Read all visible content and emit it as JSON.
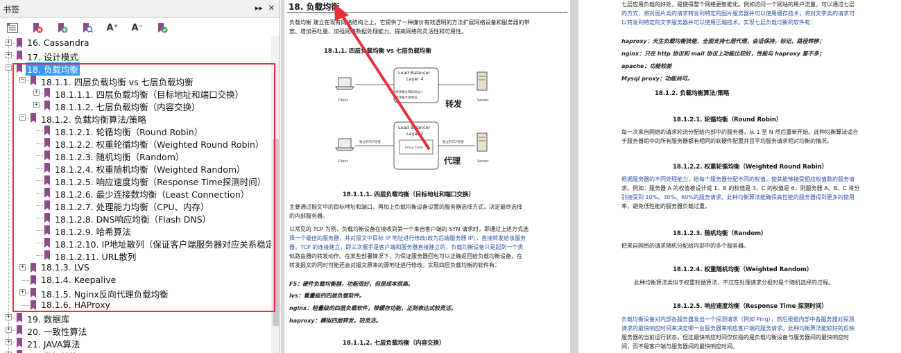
{
  "panel": {
    "title": "书签",
    "header_buttons": [
      "▸▸",
      "✕"
    ],
    "toolbar": [
      {
        "icon": "options-icon"
      },
      {
        "icon": "delete-bookmark-icon"
      },
      {
        "icon": "new-bookmark-icon"
      },
      {
        "icon": "find-bookmark-icon"
      },
      {
        "icon": "expand-text-icon",
        "text": "A⁺"
      },
      {
        "icon": "shrink-text-icon",
        "text": "A⁻"
      },
      {
        "icon": "add-child-bookmark-icon"
      }
    ]
  },
  "tree": [
    {
      "label": "16. Cassandra",
      "level": 0,
      "expander": "+"
    },
    {
      "label": "17. 设计模式",
      "level": 0,
      "expander": "+"
    },
    {
      "label": "18. 负载均衡",
      "level": 0,
      "expander": "−",
      "selected": true
    },
    {
      "label": "18.1.1. 四层负载均衡 vs 七层负载均衡",
      "level": 1,
      "expander": "−"
    },
    {
      "label": "18.1.1.1.  四层负载均衡（目标地址和端口交换）",
      "level": 2,
      "expander": "+"
    },
    {
      "label": "18.1.1.2. 七层负载均衡（内容交换）",
      "level": 2,
      "expander": "+"
    },
    {
      "label": "18.1.2. 负载均衡算法/策略",
      "level": 1,
      "expander": "−"
    },
    {
      "label": "18.1.2.1. 轮循均衡（Round Robin）",
      "level": 2,
      "expander": ""
    },
    {
      "label": "18.1.2.2. 权重轮循均衡（Weighted Round Robin）",
      "level": 2,
      "expander": ""
    },
    {
      "label": "18.1.2.3. 随机均衡（Random）",
      "level": 2,
      "expander": ""
    },
    {
      "label": "18.1.2.4. 权重随机均衡（Weighted Random）",
      "level": 2,
      "expander": ""
    },
    {
      "label": "18.1.2.5. 响应速度均衡（Response Time探测时间）",
      "level": 2,
      "expander": ""
    },
    {
      "label": "18.1.2.6. 最少连接数均衡（Least Connection）",
      "level": 2,
      "expander": ""
    },
    {
      "label": "18.1.2.7. 处理能力均衡（CPU、内存）",
      "level": 2,
      "expander": ""
    },
    {
      "label": "18.1.2.8. DNS响应均衡（Flash DNS）",
      "level": 2,
      "expander": ""
    },
    {
      "label": "18.1.2.9. 哈希算法",
      "level": 2,
      "expander": ""
    },
    {
      "label": "18.1.2.10.  IP地址散列（保证客户端服务器对应关系稳定）",
      "level": 2,
      "expander": ""
    },
    {
      "label": "18.1.2.11. URL散列",
      "level": 2,
      "expander": ""
    },
    {
      "label": "18.1.3. LVS",
      "level": 1,
      "expander": "+"
    },
    {
      "label": "18.1.4. Keepalive",
      "level": 1,
      "expander": ""
    },
    {
      "label": "18.1.5. Nginx反向代理负载均衡",
      "level": 1,
      "expander": "+"
    },
    {
      "label": "18.1.6. HAProxy",
      "level": 1,
      "expander": ""
    },
    {
      "label": "19. 数据库",
      "level": 0,
      "expander": "+"
    },
    {
      "label": "20. 一致性算法",
      "level": 0,
      "expander": "+"
    },
    {
      "label": "21. JAVA算法",
      "level": 0,
      "expander": "+"
    },
    {
      "label": "22. 数据结构",
      "level": 0,
      "expander": "+"
    }
  ],
  "left_page": {
    "heading": "18.   负载均衡",
    "intro": [
      "负载均衡 建立在现有网络结构之上，它提供了一种廉价有效透明的方法扩展网络设备和服务器的带",
      "宽、增加吞吐量、加强网络数据处理能力、提高网络的灵活性和可用性。"
    ],
    "sub_heading_1": "18.1.1.    四层负载均衡 vs 七层负载均衡",
    "diagram": {
      "lb1": "Load Balancer",
      "lb1b": "Layer 4",
      "lb2": "Load Balancer",
      "lb2b": "Layer 7",
      "proxy": "Proxy Code",
      "fwd_label": "转发",
      "proxy_label": "代理",
      "client": "Client",
      "server": "Server",
      "mod1": "修改报文目标地址+",
      "mod2": "修改报文源地址",
      "tcp1": "独立的TCP连接",
      "tcp2": "独立的TCP连接"
    },
    "sub_heading_2": "18.1.1.1.    四层负载均衡（目标地址和端口交换）",
    "para1": [
      "主要通过报文中的目标地址和端口，再加上负载均衡设备设置的服务器选择方式，决定最终选择",
      "的内部服务器。"
    ],
    "para2": [
      "以常见的 TCP 为例，负载均衡设备在接收到第一个来自客户端的 SYN 请求时，即通过上述方式选",
      "择一个最佳的服务器，并对报文中目标 IP 地址进行修改(改为后端服务器 IP），直接转发给该服务",
      "器。TCP 的连接建立，即三次握手是客户端和服务器直接建立的，负载均衡设备只是起到一个类",
      "似路由器的转发动作。在某些部署情况下，为保证服务器回包可以正确返回给负载均衡设备，在",
      "转发报文的同时可能还会对报文原来的源地址进行修改。实现四层负载均衡的软件有："
    ],
    "items": [
      "F5：硬件负载均衡器，功能很好，但是成本很高。",
      "lvs：重量级的四层负载软件。",
      "nginx：轻量级的四层负载软件，带缓存功能，正则表达式较灵活。",
      "haproxy：模拟四层转发，较灵活。"
    ],
    "sub_heading_3": "18.1.1.2.    七层负载均衡（内容交换）"
  },
  "right_page": {
    "para_top": [
      "七层应用负载的好处，是使得整个网络更智能化。例如访问一个网站的用户流量，可以通过七层",
      "的方式，将对图片类的请求转发到特定的图片服务器并可以使用缓存技术；将对文字类的请求可",
      "以转发到特定的文字服务器并可以使用压缩技术。实现七层负载均衡的软件有："
    ],
    "items": [
      "haproxy：天生负载均衡技能，全面支持七层代理，会话保持，标记，路径转移；",
      "nginx：只在 http 协议和 mail 协议上功能比较好，性能与 haproxy 差不多；",
      "apache：功能较差",
      "Mysql proxy：功能尚可。"
    ],
    "h_1_2": "18.1.2.    负载均衡算法/策略",
    "h_rr": "18.1.2.1.    轮循均衡（Round Robin）",
    "p_rr": [
      "每一次来自网络的请求轮流分配给内部中的服务器，从 1 至 N 然后重新开始。此种均衡算法适合",
      "于服务器组中的所有服务器都有相同的软硬件配置并且平均服务请求相对均衡的情况。"
    ],
    "h_wrr": "18.1.2.2.    权重轮循均衡（Weighted Round Robin）",
    "p_wrr": [
      "根据服务器的不同处理能力，给每个服务器分配不同的权值，使其能够接受相应权值数的服务请",
      "求。例如：服务器 A 的权值被设计成 1，B 的权值是 3，C 的权值是 6，则服务器 A、B、C 将分",
      "别接受到 10%、30%、60%的服务请求。此种均衡算法能确保高性能的服务器得到更多的使用",
      "率，避免低性能的服务器负载过重。"
    ],
    "h_rand": "18.1.2.3.    随机均衡（Random）",
    "p_rand": "把来自网络的请求随机分配给内部中的多个服务器。",
    "h_wrand": "18.1.2.4.    权重随机均衡（Weighted Random）",
    "p_wrand": "此种均衡算法类似于权重轮循算法，不过在处理请求分担时是个随机选择的过程。",
    "h_resp": "18.1.2.5.    响应速度均衡（Response Time 探测时间）",
    "p_resp": [
      "负载均衡设备对内部各服务器发出一个探测请求（例如 Ping），然后根据内部中各服务器对探测",
      "请求的最快响应时间来决定哪一台服务器来响应客户端的服务请求。此种均衡算法能较好的反映",
      "服务器的当前运行状态，但这最快响应时间仅仅指的是负载均衡设备与服务器间的最快响应时",
      "间，而不是客户端与服务器间的最快响应时间。"
    ]
  },
  "colors": {
    "selection": "#3399ff",
    "highlight_box": "#e8303a",
    "arrow": "#e8303a",
    "link_text": "#2a52a7",
    "bookmark_icon": "#8e4a8a"
  }
}
